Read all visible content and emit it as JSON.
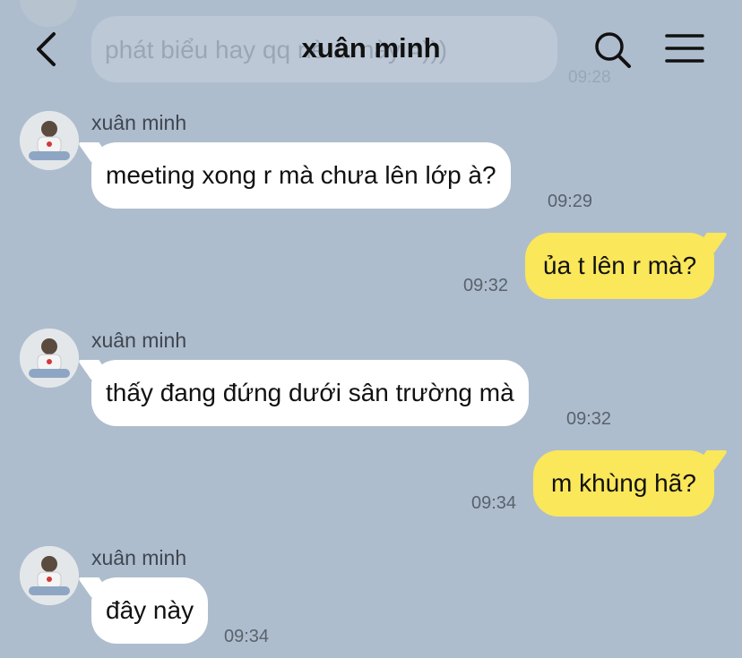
{
  "header": {
    "title": "xuân minh",
    "back_icon": "chevron-left-icon",
    "search_icon": "search-icon",
    "menu_icon": "hamburger-menu-icon"
  },
  "previous": {
    "text": "phát biểu hay qq nè ... này =)))",
    "time": "09:28"
  },
  "messages": [
    {
      "from": "xuân minh",
      "text": "meeting xong r mà chưa lên lớp à?",
      "time": "09:29",
      "outgoing": false
    },
    {
      "text": "ủa t lên r mà?",
      "time": "09:32",
      "outgoing": true
    },
    {
      "from": "xuân minh",
      "text": "thấy đang đứng dưới sân trường mà",
      "time": "09:32",
      "outgoing": false
    },
    {
      "text": "m khùng hã?",
      "time": "09:34",
      "outgoing": true
    },
    {
      "from": "xuân minh",
      "text": "đây này",
      "time": "09:34",
      "outgoing": false
    }
  ],
  "colors": {
    "background": "#aebdcd",
    "incoming_bubble": "#ffffff",
    "outgoing_bubble": "#fae75a",
    "text": "#111111",
    "timestamp": "#59626d"
  }
}
